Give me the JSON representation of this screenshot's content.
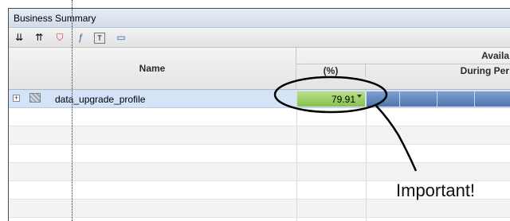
{
  "window": {
    "title": "Business Summary"
  },
  "toolbar": {
    "buttons": [
      {
        "icon": "expand-all-icon",
        "glyph": "⇊"
      },
      {
        "icon": "collapse-all-icon",
        "glyph": "⇈"
      },
      {
        "icon": "filter-icon",
        "glyph": "⛉"
      },
      {
        "icon": "function-icon",
        "glyph": "ƒ"
      },
      {
        "icon": "text-icon",
        "glyph": "T"
      },
      {
        "icon": "monitor-icon",
        "glyph": "▭"
      }
    ]
  },
  "grid": {
    "headers": {
      "name": "Name",
      "availability_group": "Availa",
      "percent": "(%)",
      "during_period": "During Per"
    },
    "rows": [
      {
        "name": "data_upgrade_profile",
        "availability_pct": "79.91",
        "availability_fraction": 0.7991
      }
    ]
  },
  "annotation": {
    "text": "Important!"
  },
  "colors": {
    "green_status": "#86c04f",
    "selection": "#d4e3f7",
    "timeline_blue": "#4f74ad"
  }
}
